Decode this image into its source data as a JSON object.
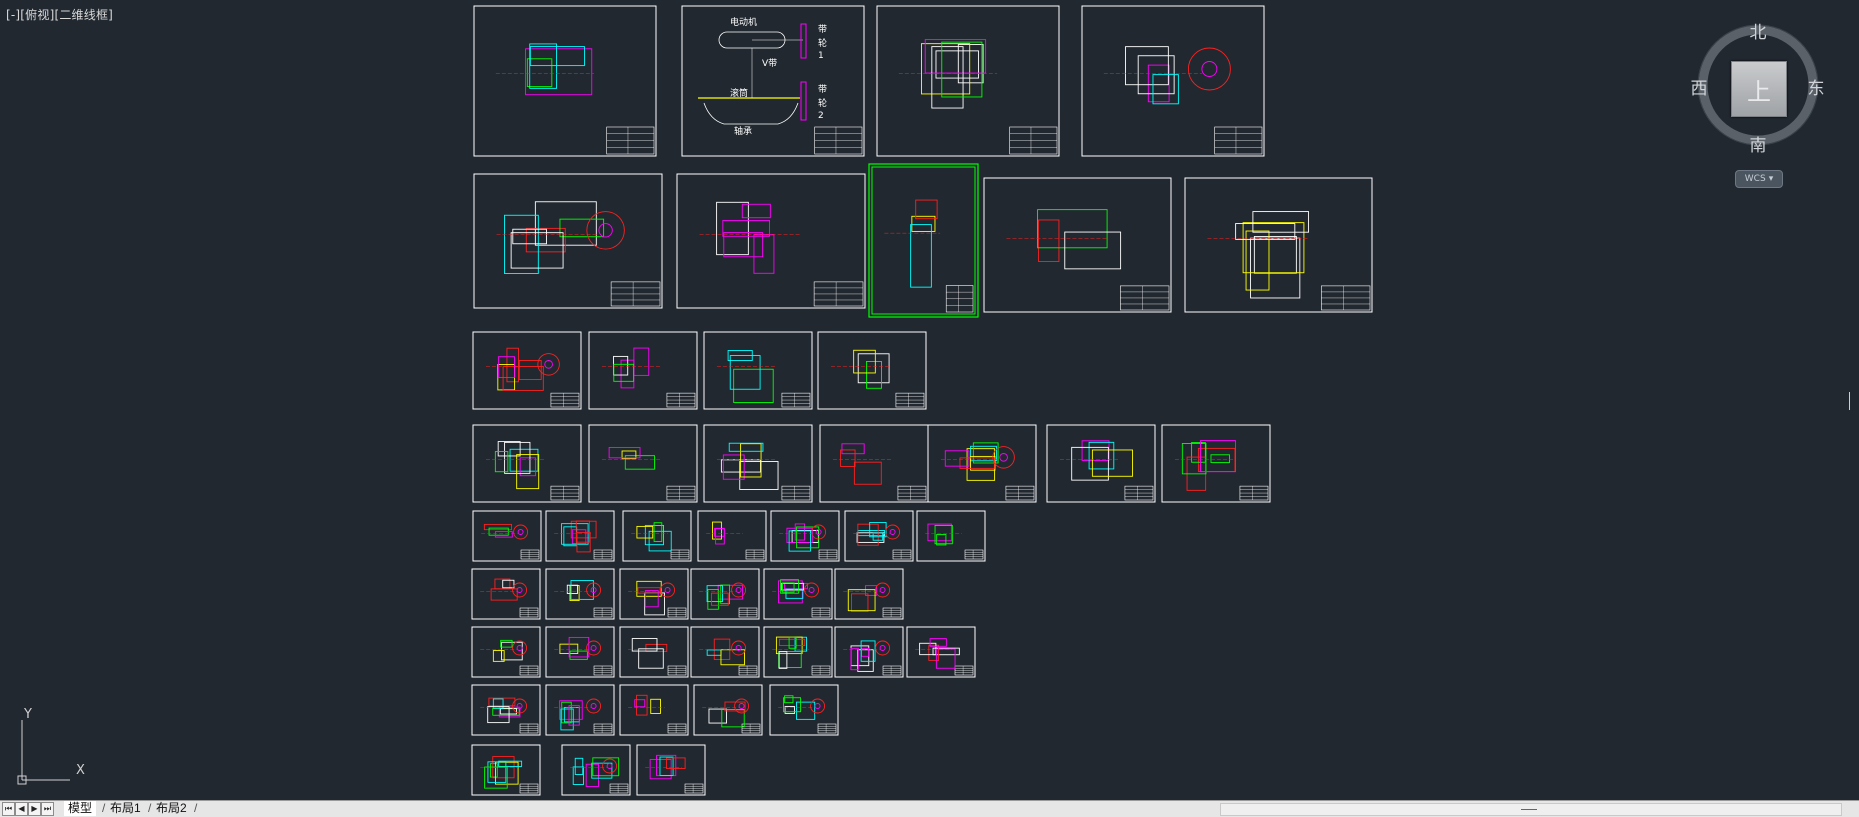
{
  "viewport": {
    "label_parts": [
      "[-]",
      "[俯视]",
      "[二维线框]"
    ]
  },
  "sheets": [
    {
      "name": "sheet-assembly-front"
    },
    {
      "name": "sheet-belt-transmission"
    },
    {
      "name": "sheet-base-plate"
    },
    {
      "name": "sheet-motor-plan"
    },
    {
      "name": "sheet-frame-assembly"
    },
    {
      "name": "sheet-column"
    },
    {
      "name": "sheet-highlighted-assembly"
    },
    {
      "name": "sheet-stand-elevation"
    },
    {
      "name": "sheet-housing"
    },
    {
      "name": "sheet-part-a1"
    },
    {
      "name": "sheet-part-a2"
    },
    {
      "name": "sheet-part-a3"
    },
    {
      "name": "sheet-part-a4"
    },
    {
      "name": "sheet-part-b1"
    },
    {
      "name": "sheet-part-b2"
    },
    {
      "name": "sheet-part-b3"
    },
    {
      "name": "sheet-part-b4"
    },
    {
      "name": "sheet-part-b5"
    },
    {
      "name": "sheet-part-b6"
    },
    {
      "name": "sheet-part-b7"
    },
    {
      "name": "sheet-part-c1"
    },
    {
      "name": "sheet-part-c2"
    },
    {
      "name": "sheet-part-c3"
    },
    {
      "name": "sheet-part-c4"
    },
    {
      "name": "sheet-part-c5"
    },
    {
      "name": "sheet-part-c6"
    },
    {
      "name": "sheet-part-c7"
    },
    {
      "name": "sheet-part-d1"
    },
    {
      "name": "sheet-part-d2"
    },
    {
      "name": "sheet-part-d3"
    },
    {
      "name": "sheet-part-d4"
    },
    {
      "name": "sheet-part-d5"
    },
    {
      "name": "sheet-part-d6"
    },
    {
      "name": "sheet-part-e1"
    },
    {
      "name": "sheet-part-e2"
    },
    {
      "name": "sheet-part-e3"
    },
    {
      "name": "sheet-part-e4"
    },
    {
      "name": "sheet-part-e5"
    },
    {
      "name": "sheet-part-e6"
    },
    {
      "name": "sheet-part-e7"
    },
    {
      "name": "sheet-part-f1"
    },
    {
      "name": "sheet-part-f2"
    },
    {
      "name": "sheet-part-f3"
    },
    {
      "name": "sheet-part-f4"
    },
    {
      "name": "sheet-part-f5"
    },
    {
      "name": "sheet-part-g1"
    },
    {
      "name": "sheet-part-g2"
    },
    {
      "name": "sheet-part-g3"
    }
  ],
  "belt_sheet_labels": {
    "motor": "电动机",
    "belt_pulley_1": [
      "带",
      "轮",
      "1"
    ],
    "v_belt": "V带",
    "drum": "滚筒",
    "belt_pulley_2": [
      "带",
      "轮",
      "2"
    ],
    "bearing": "轴承"
  },
  "viewcube": {
    "north": "北",
    "south": "南",
    "west": "西",
    "east": "东",
    "top_face": "上",
    "wcs": "WCS",
    "wcs_arrow": "▾"
  },
  "ucs": {
    "x": "X",
    "y": "Y"
  },
  "tabs": {
    "nav": [
      "⏮",
      "◀",
      "▶",
      "⏭"
    ],
    "items": [
      {
        "label": "模型",
        "active": true
      },
      {
        "label": "布局1",
        "active": false
      },
      {
        "label": "布局2",
        "active": false
      }
    ]
  },
  "colors": {
    "background": "#212830",
    "sheet_border": "#ffffff",
    "magenta": "#ff00ff",
    "red": "#ff2020",
    "yellow": "#ffff00",
    "green": "#00ff00",
    "cyan": "#00ffff"
  }
}
